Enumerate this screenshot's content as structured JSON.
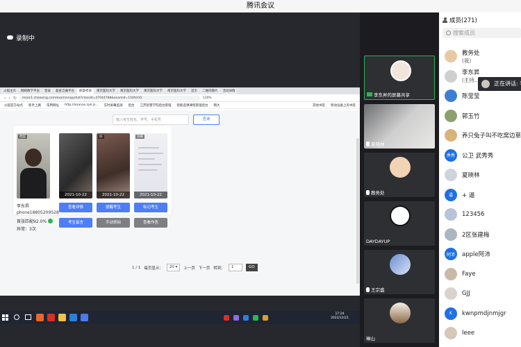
{
  "window": {
    "title": "腾讯会议"
  },
  "recording": {
    "label": "录制中"
  },
  "browser": {
    "tabs": [
      "火狐主页",
      "网络教学平台",
      "登录",
      "超星泛雅平台",
      "抓取考试",
      "南京医科大学",
      "南京医科大学",
      "南京医科大学",
      "南京医科大学",
      "首页",
      "二维码图片",
      "活动详情"
    ],
    "address": "mooc1.chaoxing.com/exam/snapshot?classId=47044788&examId=1500335",
    "zoom": "120%",
    "bookmarks": [
      "火狐官方站点",
      "新手上路",
      "常用网址",
      "http://ananas.zyk.js...",
      "实时屏幕监测",
      "后台",
      "江苏智慧学院后台管理",
      "智能选课课程管理后台",
      "网大",
      "其他书签",
      "移动设备上的书签"
    ]
  },
  "page": {
    "search_placeholder": "输入考生姓名、学号、手机号",
    "search_button": "查询",
    "student": {
      "photo_tag": "档案",
      "name": "李东昇",
      "phone": "phone18805209528",
      "match": "首张匹配92.0%",
      "abnormal": "异常：3次"
    },
    "captures": [
      {
        "date": "2021-10-22",
        "tag": ""
      },
      {
        "date": "2021-10-22",
        "tag": "抖"
      },
      {
        "date": "2021-10-22",
        "tag": "屏幕"
      }
    ],
    "buttons": {
      "view_detail": "查看详情",
      "remind": "提醒考生",
      "mark": "标记考生",
      "message": "考生留言",
      "manual_capture": "手动抓拍",
      "view_answers": "查看作答"
    },
    "pager": {
      "page": "1 / 1",
      "per_page_label": "每页显示：",
      "per_page": "20",
      "prev": "上一页",
      "next": "下一页",
      "goto_label": "转到：",
      "goto_value": "1",
      "go": "GO"
    }
  },
  "taskbar": {
    "time": "17:24",
    "date": "2022/12/21"
  },
  "videos": [
    {
      "label": "李东昇的屏幕共享"
    },
    {
      "label": "夏晓林"
    },
    {
      "label": "教务处"
    },
    {
      "label": "DAYDAYUP"
    },
    {
      "label": "王宗盛"
    },
    {
      "label": "琳山"
    }
  ],
  "members": {
    "title": "成员(271)",
    "search_placeholder": "搜索成员",
    "list": [
      {
        "name": "教务处",
        "sub": "(我)",
        "avatar_text": "",
        "color": "#e8c9a5"
      },
      {
        "name": "李东昇",
        "sub": "(主持...",
        "avatar_text": "",
        "color": "#cfcfcf"
      },
      {
        "name": "陈莹莹",
        "sub": "",
        "avatar_text": "",
        "color": "#3d7fd3"
      },
      {
        "name": "郭玉竹",
        "sub": "",
        "avatar_text": "",
        "color": "#8da070"
      },
      {
        "name": "养只兔子叫不吃窝边草",
        "sub": "",
        "avatar_text": "",
        "color": "#d9b37a"
      },
      {
        "name": "公卫 武秀秀",
        "sub": "",
        "avatar_text": "秀秀",
        "color": "#1f6fe5"
      },
      {
        "name": "夏晓林",
        "sub": "",
        "avatar_text": "",
        "color": "#cfd4db"
      },
      {
        "name": "+ 逼",
        "sub": "",
        "avatar_text": "逼",
        "color": "#1f6fe5"
      },
      {
        "name": "123456",
        "sub": "",
        "avatar_text": "",
        "color": "#b7c3d9"
      },
      {
        "name": "2区张建梅",
        "sub": "",
        "avatar_text": "",
        "color": "#aab6c4"
      },
      {
        "name": "apple阿沛",
        "sub": "",
        "avatar_text": "阿沛",
        "color": "#1f6fe5"
      },
      {
        "name": "Faye",
        "sub": "",
        "avatar_text": "",
        "color": "#c9b9a7"
      },
      {
        "name": "GJJ",
        "sub": "",
        "avatar_text": "",
        "color": "#d9d3cf"
      },
      {
        "name": "kwnpmdjnmjgr",
        "sub": "",
        "avatar_text": "K",
        "color": "#1f6fe5"
      },
      {
        "name": "leee",
        "sub": "",
        "avatar_text": "",
        "color": "#d6c7b8"
      }
    ]
  },
  "speaking": {
    "label": "正在讲话: 李"
  }
}
